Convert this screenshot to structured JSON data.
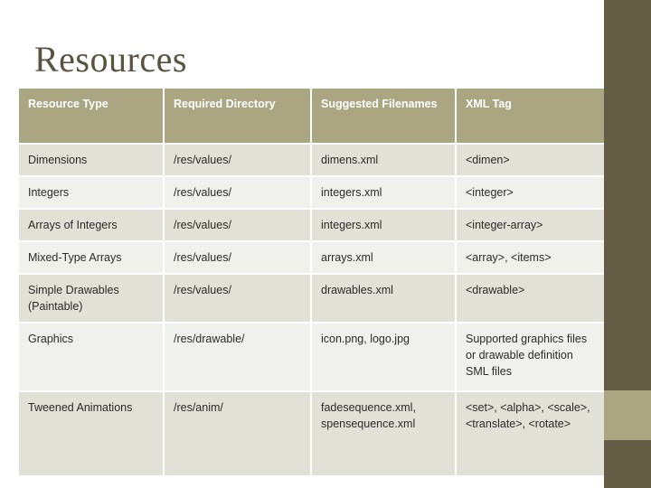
{
  "slide": {
    "title": "Resources",
    "colors": {
      "header_band": "#a9a681",
      "rail_dark": "#645c45",
      "rail_accent": "#a9a681",
      "row_shade": "#e1e1d8",
      "row_plain": "#f0f0ec",
      "title_text": "#5a5340",
      "body_text": "#2b2b28"
    }
  },
  "table": {
    "headers": [
      "Resource Type",
      "Required Directory",
      "Suggested Filenames",
      "XML Tag"
    ],
    "rows": [
      {
        "resource_type": "Dimensions",
        "required_directory": "/res/values/",
        "suggested_filenames": "dimens.xml",
        "xml_tag": "<dimen>"
      },
      {
        "resource_type": "Integers",
        "required_directory": "/res/values/",
        "suggested_filenames": "integers.xml",
        "xml_tag": "<integer>"
      },
      {
        "resource_type": "Arrays of Integers",
        "required_directory": "/res/values/",
        "suggested_filenames": "integers.xml",
        "xml_tag": "<integer-array>"
      },
      {
        "resource_type": "Mixed-Type Arrays",
        "required_directory": "/res/values/",
        "suggested_filenames": "arrays.xml",
        "xml_tag": "<array>, <items>"
      },
      {
        "resource_type": "Simple Drawables (Paintable)",
        "required_directory": "/res/values/",
        "suggested_filenames": "drawables.xml",
        "xml_tag": "<drawable>"
      },
      {
        "resource_type": "Graphics",
        "required_directory": "/res/drawable/",
        "suggested_filenames": "icon.png, logo.jpg",
        "xml_tag": "Supported graphics files or drawable definition SML files"
      },
      {
        "resource_type": "Tweened Animations",
        "required_directory": "/res/anim/",
        "suggested_filenames": "fadesequence.xml, spensequence.xml",
        "xml_tag": "<set>, <alpha>, <scale>, <translate>, <rotate>"
      }
    ]
  }
}
